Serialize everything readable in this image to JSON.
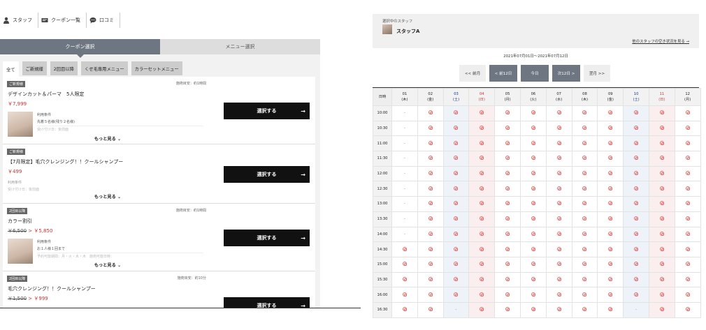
{
  "nav": [
    {
      "label": "スタッフ",
      "icon": "person-icon"
    },
    {
      "label": "クーポン一覧",
      "icon": "coupon-icon"
    },
    {
      "label": "口コミ",
      "icon": "chat-bubble-icon"
    }
  ],
  "tabs": {
    "coupon": "クーポン選択",
    "menu": "メニュー選択"
  },
  "categories": [
    "全て",
    "ご新規様",
    "2回目以降",
    "くせ毛専用メニュー",
    "カラーセットメニュー"
  ],
  "coupons": [
    {
      "badge": "ご新規様",
      "duration": "施術目安：約1時間",
      "title": "デザインカット＆パーマ　5人限定",
      "price_old": "",
      "price": "￥7,999",
      "cond_label": "利用条件",
      "cond_line": "先着５名様(残り２名様)",
      "cond_faint": "受け付け日：後前面",
      "more": "もっと見る",
      "button": "選択する",
      "thumb": true
    },
    {
      "badge": "ご新規様",
      "duration": "",
      "title": "【7月限定】毛穴クレンジング！！クールシャンプー",
      "price_old": "",
      "price": "￥499",
      "cond_label": "利用条件",
      "cond_line": "受け付け日：後前面",
      "cond_faint": "",
      "more": "もっと見る",
      "button": "選択する",
      "thumb": false
    },
    {
      "badge": "2回目以降",
      "duration": "施術目安：約1時間",
      "title": "カラー割引",
      "price_old": "￥6,500",
      "price": "￥5,850",
      "cond_label": "利用条件",
      "cond_line": "お１人様１回まで",
      "cond_faint": "予約可能期間：月・火・水・木　施術可能日時：",
      "more": "もっと見る",
      "button": "選択する",
      "thumb": true
    },
    {
      "badge": "2回目以降",
      "duration": "施術目安：約10分",
      "title": "毛穴クレンジング！！クールシャンプー",
      "price_old": "￥1,500",
      "price": "￥999",
      "cond_label": "利用条件",
      "cond_line": "",
      "cond_faint": "",
      "more": "",
      "button": "選択する",
      "thumb": true
    }
  ],
  "staff": {
    "caption": "選択中のスタッフ",
    "name": "スタッフA",
    "link": "他のスタッフの空き状況を見る →"
  },
  "range": "2021年07月01日〜2021年07月12日",
  "nav_buttons": [
    {
      "label": "<< 前月",
      "style": "light"
    },
    {
      "label": "< 前12日",
      "style": "dark"
    },
    {
      "label": "今日",
      "style": "dark"
    },
    {
      "label": "次12日 >",
      "style": "dark"
    },
    {
      "label": "翌月 >>",
      "style": "light"
    }
  ],
  "calendar": {
    "corner": "日時",
    "days": [
      {
        "d": "01",
        "w": "(木)",
        "t": ""
      },
      {
        "d": "02",
        "w": "(金)",
        "t": ""
      },
      {
        "d": "03",
        "w": "(土)",
        "t": "sat"
      },
      {
        "d": "04",
        "w": "(日)",
        "t": "sun"
      },
      {
        "d": "05",
        "w": "(月)",
        "t": ""
      },
      {
        "d": "06",
        "w": "(火)",
        "t": ""
      },
      {
        "d": "07",
        "w": "(水)",
        "t": ""
      },
      {
        "d": "08",
        "w": "(木)",
        "t": ""
      },
      {
        "d": "09",
        "w": "(金)",
        "t": ""
      },
      {
        "d": "10",
        "w": "(土)",
        "t": "sat"
      },
      {
        "d": "11",
        "w": "(日)",
        "t": "sun"
      },
      {
        "d": "12",
        "w": "(月)",
        "t": ""
      }
    ],
    "times": [
      "10:00",
      "10:30",
      "11:00",
      "11:30",
      "12:00",
      "12:30",
      "13:00",
      "13:30",
      "14:00",
      "14:30",
      "15:00",
      "15:30",
      "16:00",
      "16:30"
    ],
    "ok_symbol": "◎",
    "ng_symbol": "-",
    "availability": [
      [
        0,
        1,
        1,
        1,
        1,
        1,
        1,
        1,
        1,
        1,
        1,
        1
      ],
      [
        0,
        1,
        1,
        1,
        1,
        1,
        1,
        1,
        1,
        1,
        1,
        1
      ],
      [
        0,
        1,
        1,
        1,
        1,
        1,
        1,
        1,
        1,
        1,
        1,
        1
      ],
      [
        0,
        1,
        1,
        1,
        1,
        1,
        1,
        1,
        1,
        1,
        1,
        1
      ],
      [
        0,
        1,
        1,
        1,
        1,
        1,
        1,
        1,
        1,
        1,
        1,
        1
      ],
      [
        0,
        1,
        1,
        1,
        1,
        1,
        1,
        1,
        1,
        1,
        1,
        1
      ],
      [
        0,
        1,
        1,
        1,
        1,
        1,
        1,
        1,
        1,
        1,
        1,
        1
      ],
      [
        0,
        1,
        1,
        1,
        1,
        1,
        1,
        1,
        1,
        1,
        1,
        1
      ],
      [
        0,
        1,
        1,
        1,
        1,
        1,
        1,
        1,
        1,
        1,
        1,
        1
      ],
      [
        1,
        1,
        1,
        1,
        1,
        1,
        1,
        1,
        1,
        1,
        1,
        1
      ],
      [
        1,
        1,
        1,
        1,
        1,
        1,
        1,
        1,
        1,
        1,
        1,
        1
      ],
      [
        1,
        1,
        1,
        1,
        1,
        1,
        1,
        1,
        1,
        1,
        1,
        1
      ],
      [
        1,
        1,
        1,
        1,
        1,
        1,
        1,
        1,
        1,
        1,
        1,
        1
      ],
      [
        1,
        1,
        0,
        1,
        1,
        1,
        1,
        1,
        1,
        0,
        1,
        1
      ]
    ]
  }
}
